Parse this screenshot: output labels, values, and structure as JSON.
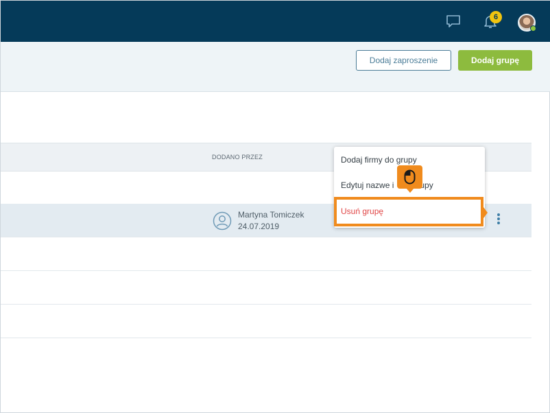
{
  "header": {
    "notifications_count": "6",
    "icons": [
      "chat-icon",
      "bell-icon",
      "avatar"
    ]
  },
  "actions": {
    "add_invite_label": "Dodaj zaproszenie",
    "add_group_label": "Dodaj grupę"
  },
  "table": {
    "columns": {
      "added_by": "DODANO PRZEZ"
    },
    "selected_row": {
      "user_name": "Martyna Tomiczek",
      "date": "24.07.2019"
    }
  },
  "context_menu": {
    "items": [
      {
        "label": "Dodaj firmy do grupy"
      },
      {
        "label": "Edytuj nazwe i",
        "label_tail": "upy"
      },
      {
        "label": "Usuń grupę"
      }
    ]
  },
  "colors": {
    "topbar": "#053a59",
    "primary_button": "#8dbb3e",
    "outline_button": "#4a7c97",
    "highlight": "#f08b1d",
    "danger_text": "#e04545",
    "badge": "#f1c40f"
  }
}
